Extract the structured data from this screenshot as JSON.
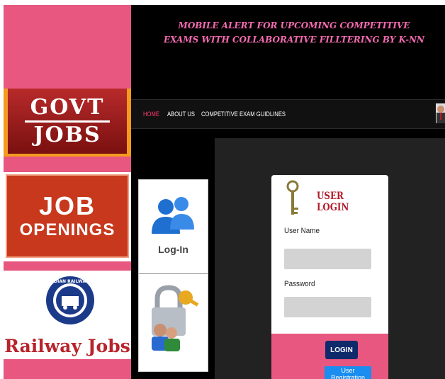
{
  "header": {
    "title": "MOBILE ALERT FOR UPCOMING COMPETITIVE EXAMS WITH COLLABORATIVE FILLTERING BY K-NN"
  },
  "nav": {
    "items": [
      {
        "label": "HOME"
      },
      {
        "label": "ABOUT US"
      },
      {
        "label": "COMPETITIVE EXAM GUIDLINES"
      }
    ]
  },
  "banners": {
    "govt": {
      "line1": "GOVT",
      "line2": "JOBS"
    },
    "job_openings": {
      "line1": "JOB",
      "line2": "OPENINGS"
    },
    "railway": {
      "text": "Railway Jobs",
      "logo_text": "INDIAN RAILWAYS"
    }
  },
  "side": {
    "login_label": "Log-In"
  },
  "login": {
    "title": "USER LOGIN",
    "username_label": "User Name",
    "password_label": "Password",
    "login_button": "LOGIN",
    "register_button": "User Registration"
  },
  "colors": {
    "accent_pink": "#e8577f",
    "login_title": "#b21d2b",
    "login_button": "#0f2a6b",
    "register_button": "#1a8df0"
  }
}
